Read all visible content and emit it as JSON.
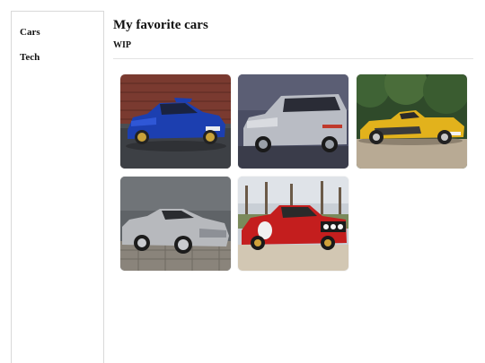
{
  "sidebar": {
    "items": [
      {
        "label": "Cars"
      },
      {
        "label": "Tech"
      }
    ]
  },
  "main": {
    "title": "My favorite cars",
    "subtitle": "WIP"
  },
  "gallery": {
    "cards": [
      {
        "name": "blue-rally-sedan"
      },
      {
        "name": "silver-hatchback"
      },
      {
        "name": "yellow-roadster"
      },
      {
        "name": "silver-sports-coupe"
      },
      {
        "name": "red-rally-car"
      }
    ]
  }
}
